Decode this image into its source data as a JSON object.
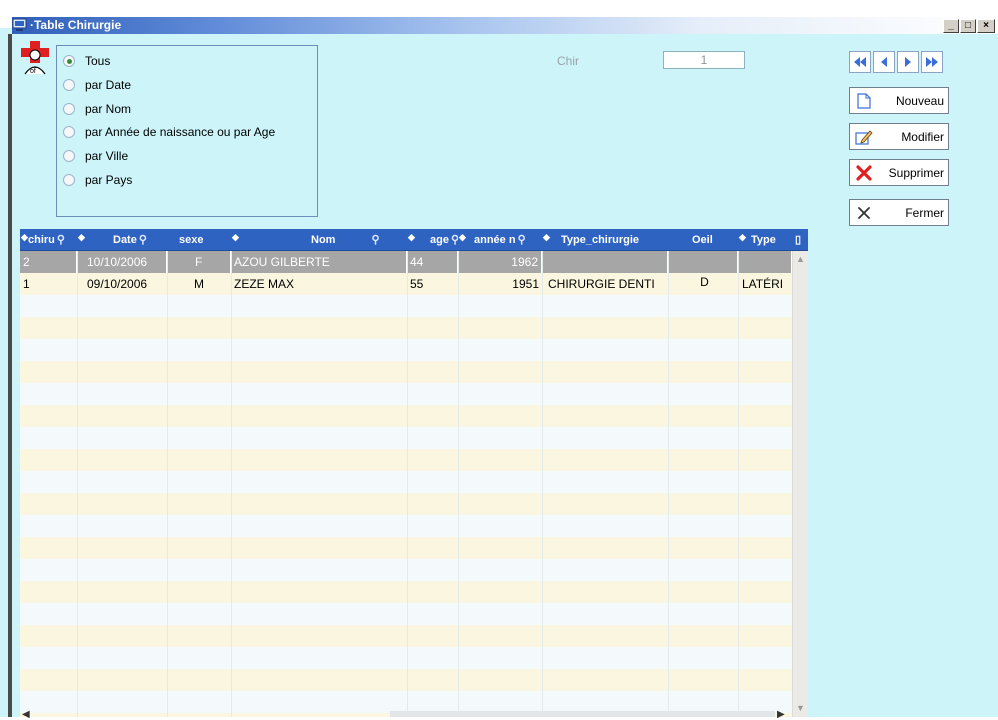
{
  "window": {
    "title": "·Table Chirurgie",
    "controls": [
      "_",
      "□",
      "×"
    ]
  },
  "filter": {
    "options": [
      {
        "label": "Tous",
        "checked": true
      },
      {
        "label": "par Date",
        "checked": false
      },
      {
        "label": "par Nom",
        "checked": false
      },
      {
        "label": "par Année de naissance ou par Age",
        "checked": false
      },
      {
        "label": "par Ville",
        "checked": false
      },
      {
        "label": "par Pays",
        "checked": false
      }
    ]
  },
  "record": {
    "chir_label": "Chir",
    "chir_value": "1"
  },
  "actions": {
    "new_label": "Nouveau",
    "edit_label": "Modifier",
    "delete_label": "Supprimer",
    "close_label": "Fermer"
  },
  "table": {
    "columns": [
      "chiru",
      "Date",
      "sexe",
      "Nom",
      "age",
      "année n",
      "Type_chirurgie",
      "Oeil",
      "Type"
    ],
    "rows": [
      [
        "2",
        "10/10/2006",
        "F",
        "AZOU GILBERTE",
        "44",
        "1962",
        "",
        "",
        ""
      ],
      [
        "1",
        "09/10/2006",
        "M",
        "ZEZE MAX",
        "55",
        "1951",
        "CHIRURGIE DENTI",
        "D",
        "LATÉRI"
      ]
    ],
    "selected_row": 0
  },
  "colors": {
    "window_bg": "#ccf4f9",
    "header_bg": "#2e63c2",
    "selected_row_bg": "#a6a6a6",
    "row_odd": "#f4fafb",
    "row_even": "#fbf6df"
  }
}
